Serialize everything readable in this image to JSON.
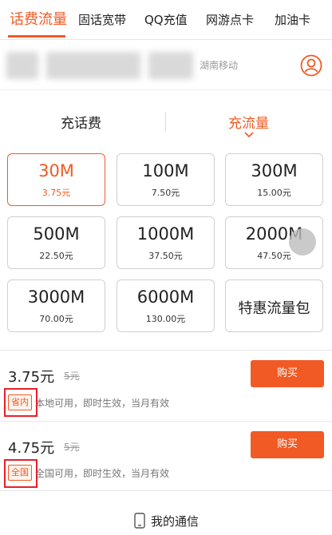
{
  "tabs": [
    {
      "label": "话费流量",
      "active": true
    },
    {
      "label": "固话宽带"
    },
    {
      "label": "QQ充值"
    },
    {
      "label": "网游点卡"
    },
    {
      "label": "加油卡"
    }
  ],
  "account": {
    "carrier": "湖南移动",
    "icon": "user-icon"
  },
  "subtabs": [
    {
      "label": "充话费"
    },
    {
      "label": "充流量",
      "active": true
    }
  ],
  "packages": [
    {
      "main": "30M",
      "sub": "3.75元",
      "selected": true
    },
    {
      "main": "100M",
      "sub": "7.50元"
    },
    {
      "main": "300M",
      "sub": "15.00元"
    },
    {
      "main": "500M",
      "sub": "22.50元"
    },
    {
      "main": "1000M",
      "sub": "37.50元"
    },
    {
      "main": "2000M",
      "sub": "47.50元"
    },
    {
      "main": "3000M",
      "sub": "70.00元"
    },
    {
      "main": "6000M",
      "sub": "130.00元"
    },
    {
      "main": "特惠流量包"
    }
  ],
  "offers": [
    {
      "price": "3.75元",
      "original": "5元",
      "button": "购买",
      "badge": "省内",
      "desc": "本地可用，即时生效，当月有效"
    },
    {
      "price": "4.75元",
      "original": "5元",
      "button": "购买",
      "badge": "全国",
      "desc": "全国可用，即时生效，当月有效"
    }
  ],
  "footer": {
    "label": "我的通信",
    "icon": "phone-icon"
  },
  "colors": {
    "accent": "#f15a24",
    "annotation": "#e8202a"
  }
}
